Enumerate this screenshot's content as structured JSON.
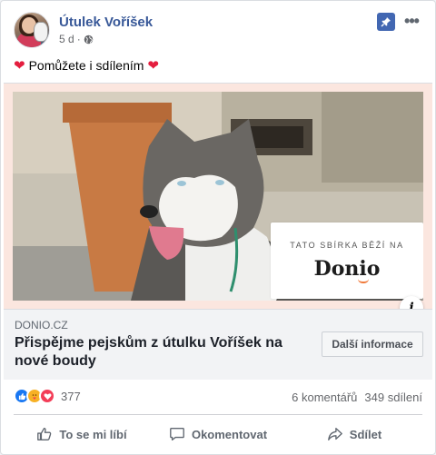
{
  "post": {
    "page_name": "Útulek Voříšek",
    "time": "5 d",
    "meta_separator": "·",
    "text": "Pomůžete i sdílením",
    "heart_glyph": "❤"
  },
  "attachment": {
    "overlay_tagline": "TATO SBÍRKA BĚŽÍ NA",
    "overlay_logo": "Donio",
    "info_label": "i",
    "domain": "DONIO.CZ",
    "title": "Přispějme pejskům z útulku Voříšek na nové boudy",
    "cta_label": "Další informace"
  },
  "stats": {
    "reaction_count": "377",
    "comments": "6 komentářů",
    "shares": "349 sdílení"
  },
  "actions": {
    "like": "To se mi líbí",
    "comment": "Okomentovat",
    "share": "Sdílet"
  },
  "icons": {
    "pin": "pin-icon",
    "more": "more-icon",
    "globe": "globe-icon",
    "like": "thumbs-up-icon",
    "comment": "comment-bubble-icon",
    "share": "share-arrow-icon"
  },
  "colors": {
    "page_link": "#385898",
    "pin_bg": "#4267b2",
    "heart": "#e41e3f",
    "like_react": "#1877f2",
    "care_react": "#f7b125",
    "love_react": "#f33e58",
    "attachment_border": "#fbe6df",
    "donio_smile": "#f07b3c"
  }
}
